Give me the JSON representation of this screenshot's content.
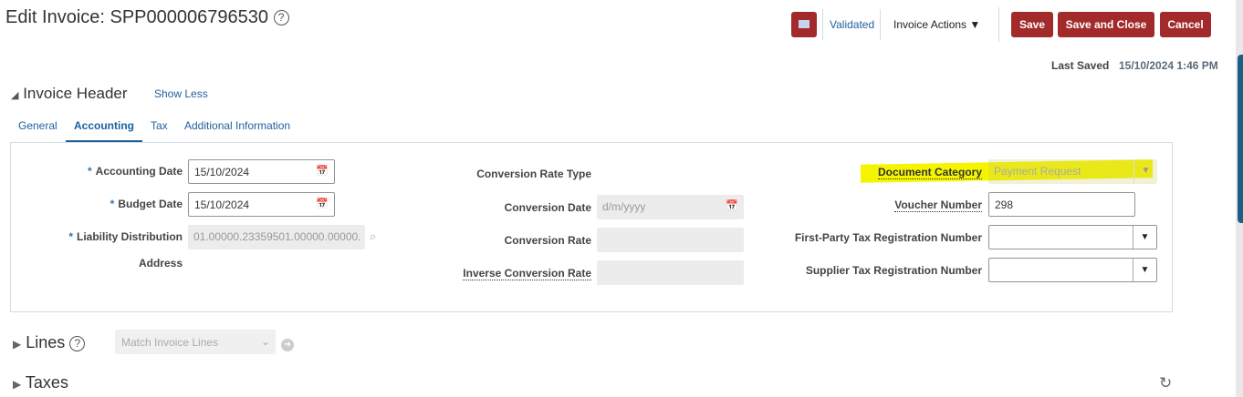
{
  "header": {
    "title": "Edit Invoice: SPP000006796530",
    "status": "Validated",
    "actions": "Invoice Actions",
    "save": "Save",
    "save_close": "Save and Close",
    "cancel": "Cancel",
    "last_saved_label": "Last Saved",
    "last_saved_value": "15/10/2024 1:46 PM"
  },
  "section": {
    "title": "Invoice Header",
    "toggle": "Show Less",
    "tabs": [
      "General",
      "Accounting",
      "Tax",
      "Additional Information"
    ],
    "active_tab": "Accounting"
  },
  "form": {
    "accounting_date": {
      "label": "Accounting Date",
      "value": "15/10/2024"
    },
    "budget_date": {
      "label": "Budget Date",
      "value": "15/10/2024"
    },
    "liability": {
      "label": "Liability Distribution",
      "label2": "Address",
      "value": "01.00000.23359501.00000.00000."
    },
    "conv_type": {
      "label": "Conversion Rate Type"
    },
    "conv_date": {
      "label": "Conversion Date",
      "placeholder": "d/m/yyyy"
    },
    "conv_rate": {
      "label": "Conversion Rate"
    },
    "inv_conv_rate": {
      "label": "Inverse Conversion Rate"
    },
    "doc_category": {
      "label": "Document Category",
      "value": "Payment Request"
    },
    "voucher": {
      "label": "Voucher Number",
      "value": "298"
    },
    "first_party": {
      "label": "First-Party Tax Registration Number"
    },
    "supplier": {
      "label": "Supplier Tax Registration Number"
    }
  },
  "lines": {
    "title": "Lines",
    "select": "Match Invoice Lines"
  },
  "taxes": {
    "title": "Taxes"
  },
  "colors": {
    "brand": "#a32a2a",
    "link": "#1f5f9e",
    "highlight": "#f5f500"
  }
}
